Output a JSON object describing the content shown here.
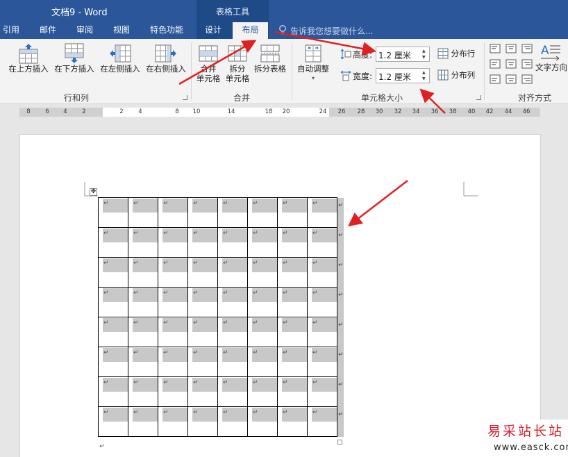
{
  "window": {
    "title": "文档9 - Word",
    "context_tool": "表格工具"
  },
  "tabs": {
    "items": [
      {
        "label": "引用"
      },
      {
        "label": "邮件"
      },
      {
        "label": "审阅"
      },
      {
        "label": "视图"
      },
      {
        "label": "特色功能"
      },
      {
        "label": "设计"
      },
      {
        "label": "布局"
      }
    ],
    "active": "布局",
    "tell_me": "告诉我您想要做什么..."
  },
  "ribbon": {
    "rows_cols": {
      "insert_above": "在上方插入",
      "insert_below": "在下方插入",
      "insert_left": "在左侧插入",
      "insert_right": "在右侧插入",
      "group": "行和列"
    },
    "merge": {
      "merge_cells": [
        "合并",
        "单元格"
      ],
      "split_cells": [
        "拆分",
        "单元格"
      ],
      "split_table": "拆分表格",
      "group": "合并"
    },
    "cell_size": {
      "autofit": "自动调整",
      "height_label": "高度:",
      "height_value": "1.2 厘米",
      "width_label": "宽度:",
      "width_value": "1.2 厘米",
      "distribute_rows": "分布行",
      "distribute_cols": "分布列",
      "group": "单元格大小"
    },
    "alignment": {
      "text_direction": "文字方向",
      "group": "对齐方式"
    }
  },
  "ruler": {
    "ticks": [
      "8",
      "6",
      "4",
      "2",
      "2",
      "4",
      "8",
      "10",
      "14",
      "18",
      "20",
      "24",
      "26",
      "28",
      "30",
      "32",
      "34",
      "36",
      "38",
      "40",
      "42",
      "44",
      "46"
    ]
  },
  "table": {
    "rows": 8,
    "cols": 8,
    "cell_mark": "↵"
  },
  "colors": {
    "accent": "#2b579a",
    "context_band": "#1e4a87",
    "arrow": "#e02020",
    "cell_shade": "#c8c8c8"
  },
  "watermark": {
    "text": "易采站长站",
    "url": "www.easck.com"
  }
}
